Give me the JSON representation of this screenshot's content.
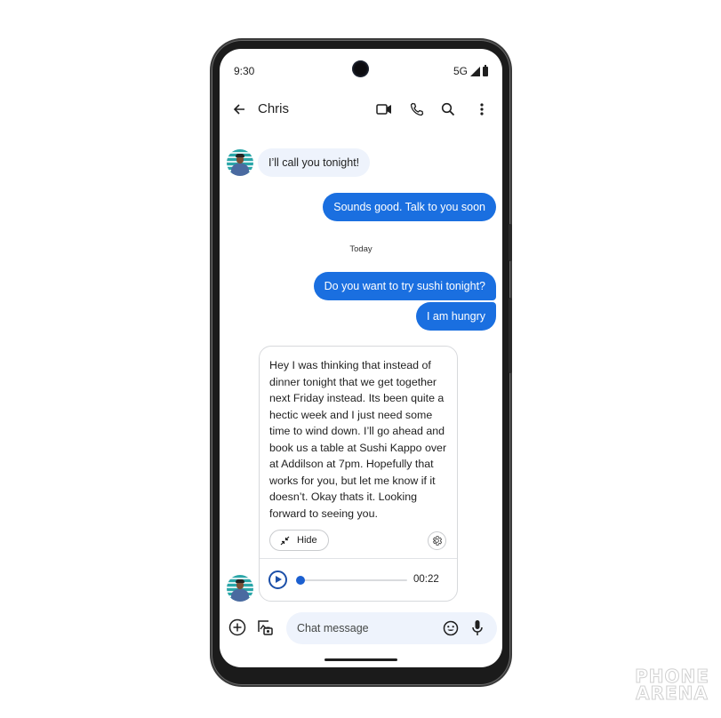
{
  "status_bar": {
    "time": "9:30",
    "network": "5G",
    "icons": [
      "signal-icon",
      "battery-icon"
    ]
  },
  "app_bar": {
    "back_icon": "arrow-left-icon",
    "contact_name": "Chris",
    "actions": [
      {
        "name": "video-call",
        "icon": "video-camera-icon"
      },
      {
        "name": "voice-call",
        "icon": "phone-icon"
      },
      {
        "name": "search",
        "icon": "search-icon"
      },
      {
        "name": "more",
        "icon": "more-vertical-icon"
      }
    ]
  },
  "conversation": {
    "messages": [
      {
        "direction": "incoming",
        "text": "I’ll call you tonight!"
      },
      {
        "direction": "outgoing",
        "text": "Sounds good. Talk to you soon"
      }
    ],
    "day_divider": "Today",
    "messages_today": [
      {
        "direction": "outgoing",
        "text": "Do you want to try sushi tonight?"
      },
      {
        "direction": "outgoing",
        "text": "I am hungry"
      }
    ],
    "voice_message": {
      "direction": "incoming",
      "transcript": "Hey I was thinking that instead of dinner tonight that we get together next Friday instead. Its been quite a hectic week and I just need some time to wind down.  I’ll go ahead and book us a table at Sushi Kappo over at Addilson at 7pm.  Hopefully that works for you, but let me know if it doesn’t. Okay thats it. Looking forward to seeing you.",
      "hide_label": "Hide",
      "duration": "00:22",
      "progress": 0.0
    }
  },
  "composer": {
    "placeholder": "Chat message",
    "icons": [
      "add-icon",
      "gallery-icon",
      "emoji-icon",
      "mic-icon"
    ]
  },
  "colors": {
    "outgoing_bubble": "#1a6fe0",
    "incoming_bubble": "#eef3fc",
    "accent": "#1b4fa8"
  },
  "watermark": {
    "line1": "PHONE",
    "line2": "ARENA"
  }
}
